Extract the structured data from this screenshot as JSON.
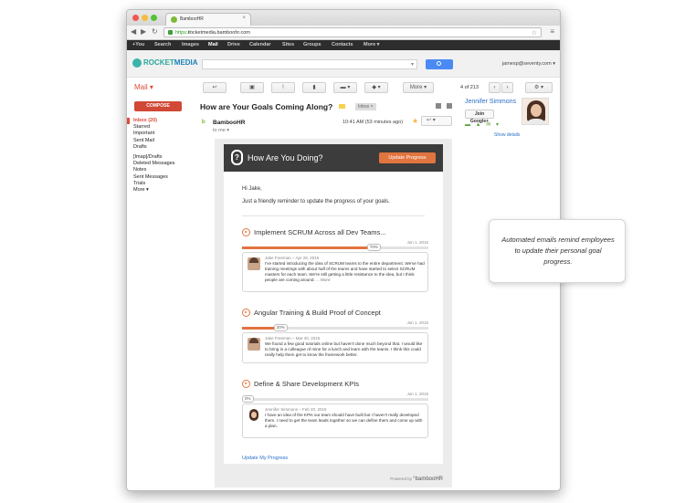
{
  "browser": {
    "tab_title": "BambooHR",
    "url_scheme": "https://",
    "url_rest": "rocketmedia.bamboohr.com",
    "tab_close": "×",
    "star_icon": "☆",
    "menu_icon": "≡",
    "back_icon": "◀",
    "forward_icon": "▶",
    "reload_icon": "↻"
  },
  "google_bar": {
    "items": [
      "+You",
      "Search",
      "Images",
      "Mail",
      "Drive",
      "Calendar",
      "Sites",
      "Groups",
      "Contacts",
      "More ▾"
    ],
    "active": "Mail"
  },
  "gmail_header": {
    "logo_part1": "ROCKET",
    "logo_part2": "MEDIA",
    "search_dropdown": "▾",
    "account": "jamesp@seventy.com ▾"
  },
  "toolbar": {
    "mail_label": "Mail ▾",
    "reply_icon": "↩",
    "archive_icon": "▣",
    "spam_icon": "!",
    "delete_icon": "▮",
    "folder_icon": "▬ ▾",
    "label_icon": "◆ ▾",
    "more_label": "More ▾",
    "count": "4 of 213",
    "prev_icon": "‹",
    "next_icon": "›",
    "settings_icon": "⚙ ▾"
  },
  "sidebar": {
    "compose_label": "COMPOSE",
    "items": [
      "Inbox (20)",
      "Starred",
      "Important",
      "Sent Mail",
      "Drafts",
      "[Imap]/Drafts",
      "Deleted Messages",
      "Notes",
      "Sent Messages",
      "Trials",
      "More ▾"
    ]
  },
  "message": {
    "subject": "How are Your Goals Coming Along?",
    "inbox_chip": "Inbox  ×",
    "sender": "BambooHR",
    "sender_icon": "ᵇ",
    "to": "to me ▾",
    "date": "10:41 AM (53 minutes ago)",
    "star": "★",
    "reply_button": "↩     ▾"
  },
  "contact": {
    "name": "Jennifer Simmons",
    "gplus_label": "Join Google+",
    "icons": "▬ ▲ ✉ ▾",
    "show_details": "Show details"
  },
  "email": {
    "header_title": "How Are You Doing?",
    "question_icon": "?",
    "update_button": "Update Progress",
    "greeting": "Hi Jake,",
    "intro": "Just a friendly reminder to update the progress of your goals.",
    "goals": [
      {
        "title": "Implement SCRUM Across all Dev Teams...",
        "date": "Jun 1, 2015",
        "progress": 70,
        "progress_label": "70%",
        "author": "Jake Freeman – Apr 28, 2015",
        "comment": "I've started introducing the idea of SCRUM teams to the entire department. We've had training meetings with about half of the teams and have started to select SCRUM masters for each team. We're still getting a little resistance to the idea, but I think people are coming around.",
        "more": "... More"
      },
      {
        "title": "Angular Training & Build Proof of Concept",
        "date": "Jun 1, 2015",
        "progress": 20,
        "progress_label": "20%",
        "author": "Jake Freeman – Mar 30, 2015",
        "comment": "We found a few good tutorials online but haven't done much beyond that. I would like to bring in a colleague of mine for a lunch and learn with the teams. I think this could really help them get to know the framework better.",
        "more": ""
      },
      {
        "title": "Define & Share Development KPIs",
        "date": "Jun 1, 2015",
        "progress": 0,
        "progress_label": "0%",
        "author": "Jennifer Simmons – Feb 20, 2015",
        "comment": "I have an idea of the KPIs our team should have built but I haven't really developed them. I need to get the team leads together so we can define them and come up with a plan.",
        "more": ""
      }
    ],
    "update_link": "Update My Progress",
    "powered_by": "Powered by",
    "powered_brand": "°bambooHR"
  },
  "callout": {
    "text": "Automated emails remind employees to update their personal goal progress."
  },
  "colors": {
    "accent_orange": "#e2743f",
    "gmail_red": "#dd4b39",
    "link_blue": "#2a6fc9"
  }
}
